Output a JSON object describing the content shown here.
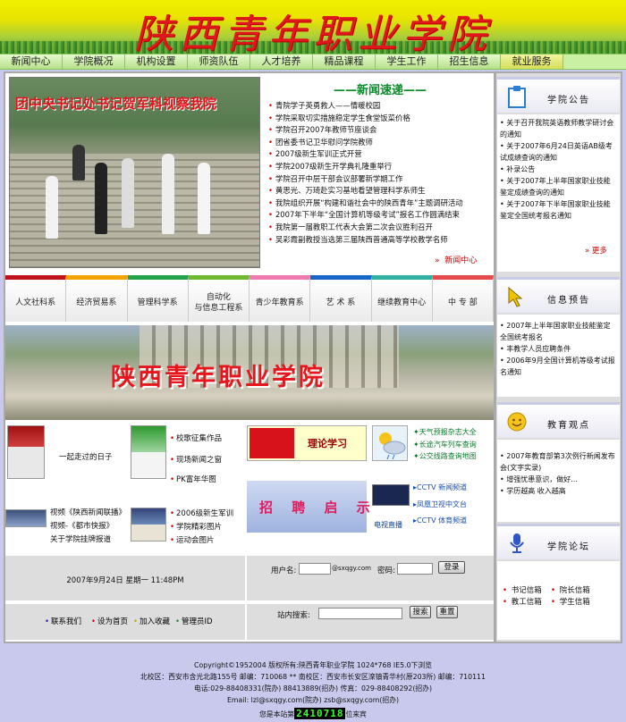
{
  "banner": {
    "title": "陕西青年职业学院"
  },
  "nav": [
    "新闻中心",
    "学院概况",
    "机构设置",
    "师资队伍",
    "人才培养",
    "精品课程",
    "学生工作",
    "招生信息",
    "就业服务"
  ],
  "photo1": {
    "caption": "团中央书记处书记贺军科视察我院"
  },
  "news": {
    "title": "新闻速递",
    "items": [
      "青院学子英勇救人——情暖校园",
      "学院采取切实措施稳定学生食堂饭菜价格",
      "学院召开2007年教师节座谈会",
      "团省委书记卫华慰问学院教师",
      "2007级新生军训正式开营",
      "学院2007级新生开学典礼隆重举行",
      "学院召开中层干部会议部署新学期工作",
      "黄思光、万琦赴实习基地看望管理科学系师生",
      "我院组织开展“构建和谐社会中的陕西青年”主题调研活动",
      "2007年下半年“全国计算机等级考试”报名工作圆满结束",
      "我院第一届教职工代表大会第二次会议胜利召开",
      "吴彩霞副教授当选第三届陕西普通高等学校教学名师"
    ],
    "more": "新闻中心"
  },
  "tabs": [
    {
      "label": "人文社科系",
      "color": "#c0121a"
    },
    {
      "label": "经济贸易系",
      "color": "#f2a300"
    },
    {
      "label": "管理科学系",
      "color": "#22a34a"
    },
    {
      "label": "自动化\n与信息工程系",
      "color": "#6fb82c"
    },
    {
      "label": "青少年教育系",
      "color": "#f07ab0"
    },
    {
      "label": "艺 术 系",
      "color": "#1866c9"
    },
    {
      "label": "继续教育中心",
      "color": "#2fb0a0"
    },
    {
      "label": "中 专 部",
      "color": "#e64b4b"
    }
  ],
  "photo2": {
    "caption": "陕西青年职业学院"
  },
  "blocks": {
    "days": "一起走过的日子",
    "works": [
      "校歌征集作品",
      "现场新闻之窗",
      "PK富年华图"
    ],
    "videos": [
      "视频《陕西新闻联播》",
      "视频-《都市快报》",
      "关于学院挂牌报道"
    ],
    "news2": [
      "2006级新生军训",
      "学院精彩图片",
      "运动会图片"
    ],
    "theory": "理论学习",
    "links3": [
      "天气预报杂志大全",
      "长途汽车列车查询",
      "公交线路查询地图"
    ],
    "recruit": "招 聘 启 示",
    "tv_label": "电视直播",
    "tv": [
      "CCTV 新闻频道",
      "凤凰卫视中文台",
      "CCTV 体育频道"
    ]
  },
  "status": {
    "date": "2007年9月24日 星期一 11:48PM"
  },
  "login": {
    "user_label": "用户名:",
    "domain": "@sxqgy.com",
    "pwd_label": "密码:",
    "login_btn": "登录"
  },
  "search": {
    "label": "站内搜索:",
    "search_btn": "搜索",
    "reset_btn": "重置"
  },
  "footer_links": [
    "联系我们",
    "设为首页",
    "加入收藏",
    "管理员ID"
  ],
  "side": {
    "announce": {
      "title": "学院公告",
      "items": [
        "关于召开我院英语教师教学研讨会的通知",
        "关于2007年6月24日英语AB级考试成绩查询的通知",
        "补录公告",
        "关于2007年上半年国家职业技能鉴定成绩查询的通知",
        "关于2007年下半年国家职业技能鉴定全国统考报名通知"
      ],
      "more": "更多"
    },
    "info": {
      "title": "信息预告",
      "items": [
        "2007年上半年国家职业技能鉴定全国统考报名",
        "丰教学人员应聘条件",
        "2006年9月全国计算机等级考试报名通知"
      ]
    },
    "views": {
      "title": "教育观点",
      "items": [
        "2007年教育部第3次例行新闻发布会(文字实录)",
        "增强忧患意识，做好...",
        "学历越高 收入越高"
      ]
    },
    "forum": {
      "title": "学院论坛",
      "items": [
        "书记信箱",
        "院长信箱",
        "教工信箱",
        "学生信箱"
      ]
    }
  },
  "copyright": {
    "lines": [
      "Copyright©1952004 版权所有:陕西青年职业学院 1024*768 IE5.0下浏览",
      "北校区：西安市含光北路155号 邮编：710068 ** 南校区：西安市长安区滦镇青华村(原203所) 邮编：710111",
      "电话:029-88408331(院办) 88413889(招办) 传真：029-88408292(招办)",
      "Email: lzl@sxqgy.com(院办) zsb@sxqgy.com(招办)"
    ],
    "visit_prefix": "您是本站第",
    "counter": "2410718",
    "visit_suffix": "位来宾"
  }
}
